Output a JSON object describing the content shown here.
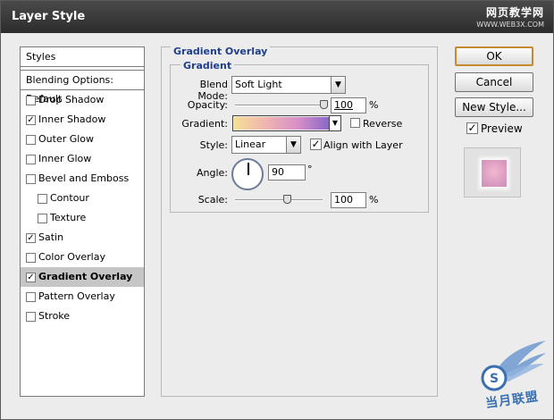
{
  "window": {
    "title": "Layer Style"
  },
  "watermark": {
    "text": "网页教学网",
    "url": "WWW.WEB3X.COM",
    "logo_text": "当月联盟"
  },
  "sidebar": {
    "styles_label": "Styles",
    "blending_label": "Blending Options: Default",
    "items": [
      {
        "label": "Drop Shadow",
        "checked": false
      },
      {
        "label": "Inner Shadow",
        "checked": true
      },
      {
        "label": "Outer Glow",
        "checked": false
      },
      {
        "label": "Inner Glow",
        "checked": false
      },
      {
        "label": "Bevel and Emboss",
        "checked": false
      },
      {
        "label": "Contour",
        "checked": false
      },
      {
        "label": "Texture",
        "checked": false
      },
      {
        "label": "Satin",
        "checked": true
      },
      {
        "label": "Color Overlay",
        "checked": false
      },
      {
        "label": "Gradient Overlay",
        "checked": true,
        "selected": true
      },
      {
        "label": "Pattern Overlay",
        "checked": false
      },
      {
        "label": "Stroke",
        "checked": false
      }
    ]
  },
  "panel": {
    "section_title": "Gradient Overlay",
    "group_title": "Gradient",
    "blend_mode": {
      "label": "Blend Mode:",
      "value": "Soft Light"
    },
    "opacity": {
      "label": "Opacity:",
      "value": "100",
      "unit": "%",
      "level": 1.0
    },
    "gradient": {
      "label": "Gradient:",
      "reverse_label": "Reverse",
      "reverse_checked": false,
      "colors": [
        "#f5df94",
        "#f0b5b0",
        "#d890c8",
        "#8a68c8"
      ]
    },
    "style": {
      "label": "Style:",
      "value": "Linear",
      "align_label": "Align with Layer",
      "align_checked": true
    },
    "angle": {
      "label": "Angle:",
      "value": "90",
      "unit": "°"
    },
    "scale": {
      "label": "Scale:",
      "value": "100",
      "unit": "%",
      "level": 0.6
    }
  },
  "buttons": {
    "ok": "OK",
    "cancel": "Cancel",
    "new_style": "New Style..."
  },
  "preview": {
    "label": "Preview",
    "checked": true
  },
  "colors": {
    "title_bg": "#2c2c2c",
    "section_title": "#1f3f8e",
    "selected_row": "#c6c6c6",
    "default_button_border": "#c88a30"
  }
}
